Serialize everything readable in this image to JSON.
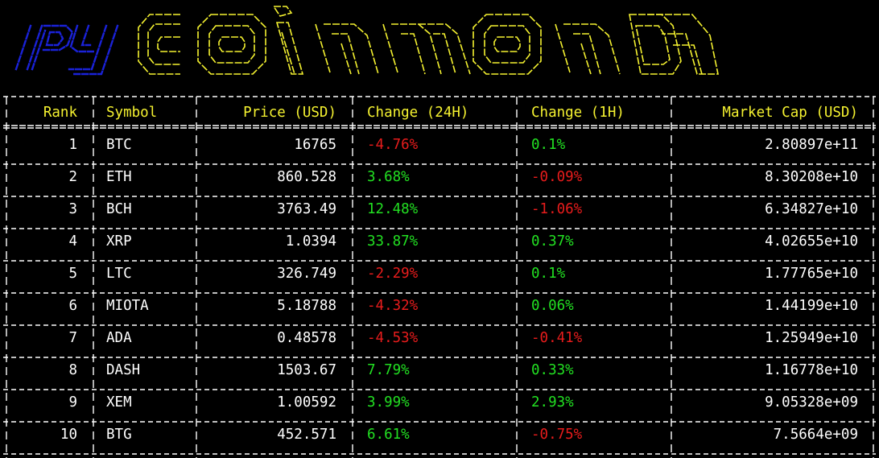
{
  "banner": {
    "prefix": "py",
    "word": "coinmon",
    "prefix_color": "#1a22d8",
    "word_color": "#f5f230"
  },
  "table": {
    "header_color": "#f5f230",
    "positive_color": "#22e022",
    "negative_color": "#e81c1c",
    "headers": [
      "Rank",
      "Symbol",
      "Price (USD)",
      "Change (24H)",
      "Change (1H)",
      "Market Cap (USD)"
    ],
    "rows": [
      {
        "rank": "1",
        "symbol": "BTC",
        "price": "16765",
        "change24h": "-4.76%",
        "change1h": "0.1%",
        "market_cap": "2.80897e+11"
      },
      {
        "rank": "2",
        "symbol": "ETH",
        "price": "860.528",
        "change24h": "3.68%",
        "change1h": "-0.09%",
        "market_cap": "8.30208e+10"
      },
      {
        "rank": "3",
        "symbol": "BCH",
        "price": "3763.49",
        "change24h": "12.48%",
        "change1h": "-1.06%",
        "market_cap": "6.34827e+10"
      },
      {
        "rank": "4",
        "symbol": "XRP",
        "price": "1.0394",
        "change24h": "33.87%",
        "change1h": "0.37%",
        "market_cap": "4.02655e+10"
      },
      {
        "rank": "5",
        "symbol": "LTC",
        "price": "326.749",
        "change24h": "-2.29%",
        "change1h": "0.1%",
        "market_cap": "1.77765e+10"
      },
      {
        "rank": "6",
        "symbol": "MIOTA",
        "price": "5.18788",
        "change24h": "-4.32%",
        "change1h": "0.06%",
        "market_cap": "1.44199e+10"
      },
      {
        "rank": "7",
        "symbol": "ADA",
        "price": "0.48578",
        "change24h": "-4.53%",
        "change1h": "-0.41%",
        "market_cap": "1.25949e+10"
      },
      {
        "rank": "8",
        "symbol": "DASH",
        "price": "1503.67",
        "change24h": "7.79%",
        "change1h": "0.33%",
        "market_cap": "1.16778e+10"
      },
      {
        "rank": "9",
        "symbol": "XEM",
        "price": "1.00592",
        "change24h": "3.99%",
        "change1h": "2.93%",
        "market_cap": "9.05328e+09"
      },
      {
        "rank": "10",
        "symbol": "BTG",
        "price": "452.571",
        "change24h": "6.61%",
        "change1h": "-0.75%",
        "market_cap": "7.5664e+09"
      }
    ]
  }
}
